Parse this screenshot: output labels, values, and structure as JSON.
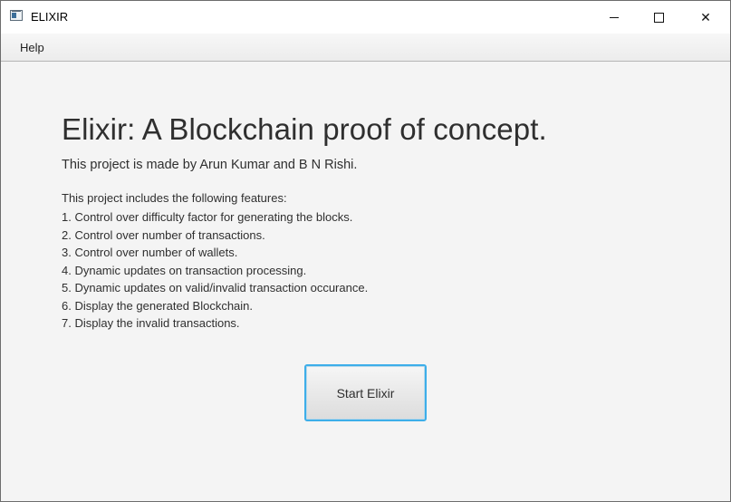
{
  "window": {
    "title": "ELIXIR",
    "controls": {
      "minimize_icon": "minimize-icon",
      "maximize_icon": "maximize-icon",
      "close_glyph": "✕"
    }
  },
  "menubar": {
    "items": [
      {
        "label": "Help"
      }
    ]
  },
  "main": {
    "heading": "Elixir: A Blockchain proof of concept.",
    "authors": "This project is made by Arun Kumar and B N Rishi.",
    "features_intro": "This project includes the following features:",
    "features": [
      "1. Control over difficulty factor for generating the blocks.",
      "2. Control over number of transactions.",
      "3. Control over number of wallets.",
      "4. Dynamic updates on transaction processing.",
      "5. Dynamic updates on valid/invalid transaction occurance.",
      "6. Display the generated Blockchain.",
      "7. Display the invalid transactions."
    ],
    "start_button_label": "Start Elixir"
  },
  "colors": {
    "button_focus_border": "#3daee9",
    "text": "#2f2f2f",
    "background": "#f4f4f4"
  }
}
